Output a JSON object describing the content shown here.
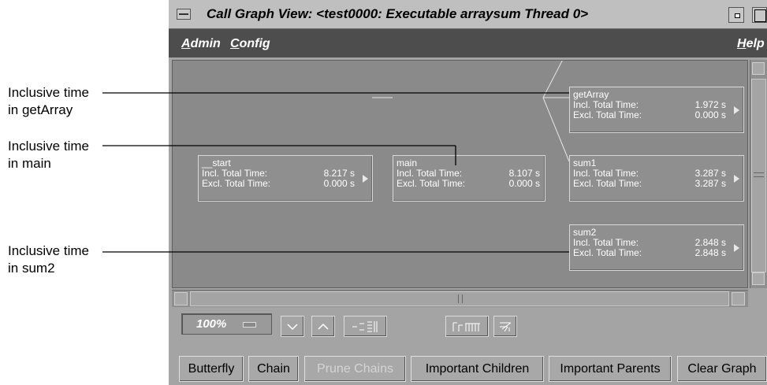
{
  "annotations": [
    {
      "line1": "Inclusive time",
      "line2": "in getArray"
    },
    {
      "line1": "Inclusive time",
      "line2": "in main"
    },
    {
      "line1": "Inclusive time",
      "line2": "in sum2"
    }
  ],
  "window": {
    "title": "Call Graph View: <test0000: Executable arraysum Thread 0>"
  },
  "menubar": {
    "admin": "Admin",
    "config": "Config",
    "help": "Help"
  },
  "nodes": {
    "start": {
      "name": "__start",
      "incl_label": "Incl. Total Time:",
      "incl": "8.217 s",
      "excl_label": "Excl. Total Time:",
      "excl": "0.000 s"
    },
    "main": {
      "name": "main",
      "incl_label": "Incl. Total Time:",
      "incl": "8.107 s",
      "excl_label": "Excl. Total Time:",
      "excl": "0.000 s"
    },
    "getArray": {
      "name": "getArray",
      "incl_label": "Incl. Total Time:",
      "incl": "1.972 s",
      "excl_label": "Excl. Total Time:",
      "excl": "0.000 s"
    },
    "sum1": {
      "name": "sum1",
      "incl_label": "Incl. Total Time:",
      "incl": "3.287 s",
      "excl_label": "Excl. Total Time:",
      "excl": "3.287 s"
    },
    "sum2": {
      "name": "sum2",
      "incl_label": "Incl. Total Time:",
      "incl": "2.848 s",
      "excl_label": "Excl. Total Time:",
      "excl": "2.848 s"
    }
  },
  "toolbar": {
    "zoom": "100%"
  },
  "buttons": {
    "butterfly": "Butterfly",
    "chain": "Chain",
    "prune_chains": "Prune Chains",
    "important_children": "Important Children",
    "important_parents": "Important Parents",
    "clear_graph": "Clear Graph"
  }
}
